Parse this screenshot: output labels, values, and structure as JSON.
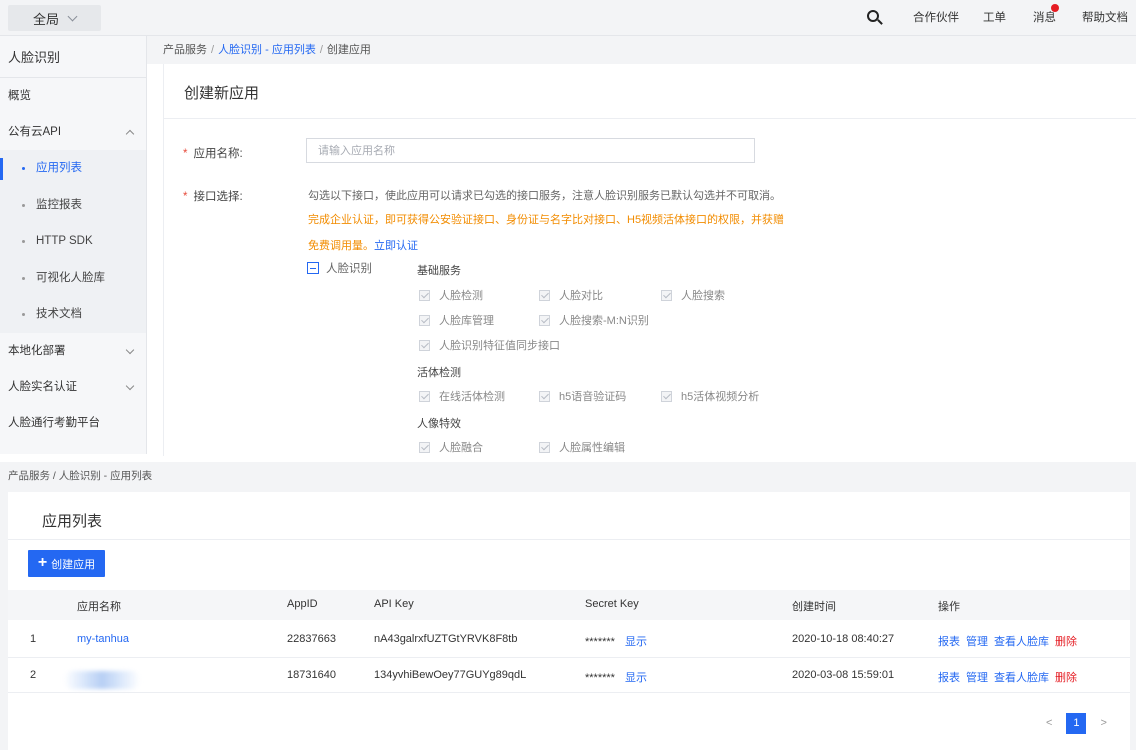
{
  "topbar": {
    "scope_label": "全局",
    "nav": [
      "合作伙伴",
      "工单",
      "消息",
      "帮助文档"
    ]
  },
  "sidebar": {
    "title": "人脸识别",
    "items": {
      "overview": "概览",
      "public_api": "公有云API",
      "local_deploy": "本地化部署",
      "real_name": "人脸实名认证",
      "attendance": "人脸通行考勤平台"
    },
    "subitems": [
      "应用列表",
      "监控报表",
      "HTTP SDK",
      "可视化人脸库",
      "技术文档"
    ]
  },
  "create_page": {
    "breadcrumb": {
      "root": "产品服务",
      "link": "人脸识别 - 应用列表",
      "current": "创建应用"
    },
    "title": "创建新应用",
    "name_label": "应用名称:",
    "name_placeholder": "请输入应用名称",
    "api_label": "接口选择:",
    "info": "勾选以下接口，使此应用可以请求已勾选的接口服务，注意人脸识别服务已默认勾选并不可取消。",
    "warn_line1": "完成企业认证，即可获得公安验证接口、身份证与名字比对接口、H5视频活体接口的权限，并获赠",
    "warn_line2": "免费调用量。",
    "verify_link": "立即认证",
    "tree_label": "人脸识别",
    "groups": {
      "basic": "基础服务",
      "liveness": "活体检测",
      "effects": "人像特效"
    },
    "checkboxes": {
      "detect": "人脸检测",
      "compare": "人脸对比",
      "search": "人脸搜索",
      "library": "人脸库管理",
      "search_mn": "人脸搜索-M:N识别",
      "sync": "人脸识别特征值同步接口",
      "online_live": "在线活体检测",
      "h5_voice": "h5语音验证码",
      "h5_video": "h5活体视频分析",
      "fusion": "人脸融合",
      "attr_edit": "人脸属性编辑"
    }
  },
  "list_page": {
    "breadcrumb": "产品服务 / 人脸识别 - 应用列表",
    "title": "应用列表",
    "create_button": "创建应用",
    "columns": [
      "应用名称",
      "AppID",
      "API Key",
      "Secret Key",
      "创建时间",
      "操作"
    ],
    "rows": [
      {
        "index": "1",
        "name": "my-tanhua",
        "app_id": "22837663",
        "api_key": "nA43galrxfUZTGtYRVK8F8tb",
        "secret": "*******",
        "show": "显示",
        "created": "2020-10-18 08:40:27"
      },
      {
        "index": "2",
        "name": "",
        "app_id": "18731640",
        "api_key": "134yvhiBewOey77GUYg89qdL",
        "secret": "*******",
        "show": "显示",
        "created": "2020-03-08 15:59:01"
      }
    ],
    "actions": {
      "report": "报表",
      "manage": "管理",
      "view_library": "查看人脸库",
      "delete": "删除"
    },
    "pager": {
      "prev": "<",
      "current": "1",
      "next": ">"
    }
  }
}
